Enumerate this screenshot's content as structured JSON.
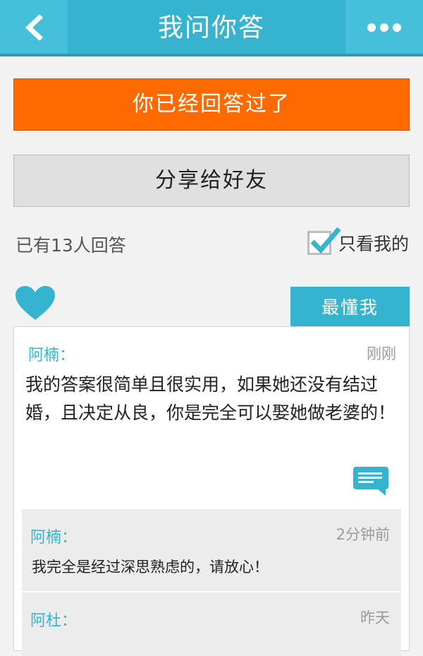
{
  "header": {
    "title": "我问你答",
    "back_icon": "chevron-left-icon",
    "more_icon": "more-dots-icon"
  },
  "actions": {
    "answered_label": "你已经回答过了",
    "share_label": "分享给好友"
  },
  "filter": {
    "answer_count_text": "已有13人回答",
    "only_mine_label": "只看我的",
    "only_mine_checked": true
  },
  "tabs": {
    "best_label": "最懂我",
    "heart_icon": "heart-icon"
  },
  "answer": {
    "author": "阿楠：",
    "time": "刚刚",
    "content": "我的答案很简单且很实用，如果她还没有结过婚，且决定从良，你是完全可以娶她做老婆的！",
    "replies": [
      {
        "author": "阿楠：",
        "time": "2分钟前",
        "text": "我完全是经过深思熟虑的，请放心！"
      },
      {
        "author": "阿杜：",
        "time": "昨天",
        "text": ""
      }
    ]
  },
  "colors": {
    "accent": "#35b3cf",
    "orange": "#ff6a00"
  }
}
